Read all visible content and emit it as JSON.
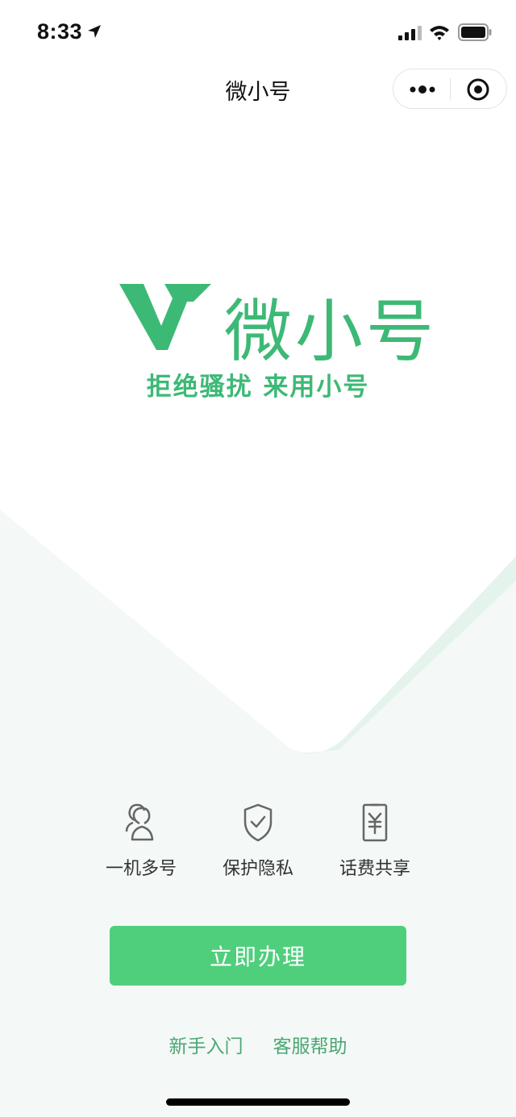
{
  "status_bar": {
    "time": "8:33",
    "icons": [
      "location-arrow-icon",
      "cellular-signal-icon",
      "wifi-icon",
      "battery-icon"
    ]
  },
  "nav": {
    "title": "微小号",
    "capsule_icons": [
      "more-icon",
      "target-icon"
    ]
  },
  "logo": {
    "text": "微小号",
    "mark_icon": "w-logo-mark"
  },
  "slogan": "拒绝骚扰 来用小号",
  "features": [
    {
      "label": "一机多号",
      "icon": "users-icon"
    },
    {
      "label": "保护隐私",
      "icon": "shield-check-icon"
    },
    {
      "label": "话费共享",
      "icon": "phone-yuan-icon"
    }
  ],
  "cta_label": "立即办理",
  "links": {
    "beginner": "新手入门",
    "support": "客服帮助"
  },
  "colors": {
    "brand_green": "#3db976",
    "button_green": "#4fcf7c",
    "link_green": "#4aa772",
    "background_tint": "#f3f8f6"
  }
}
